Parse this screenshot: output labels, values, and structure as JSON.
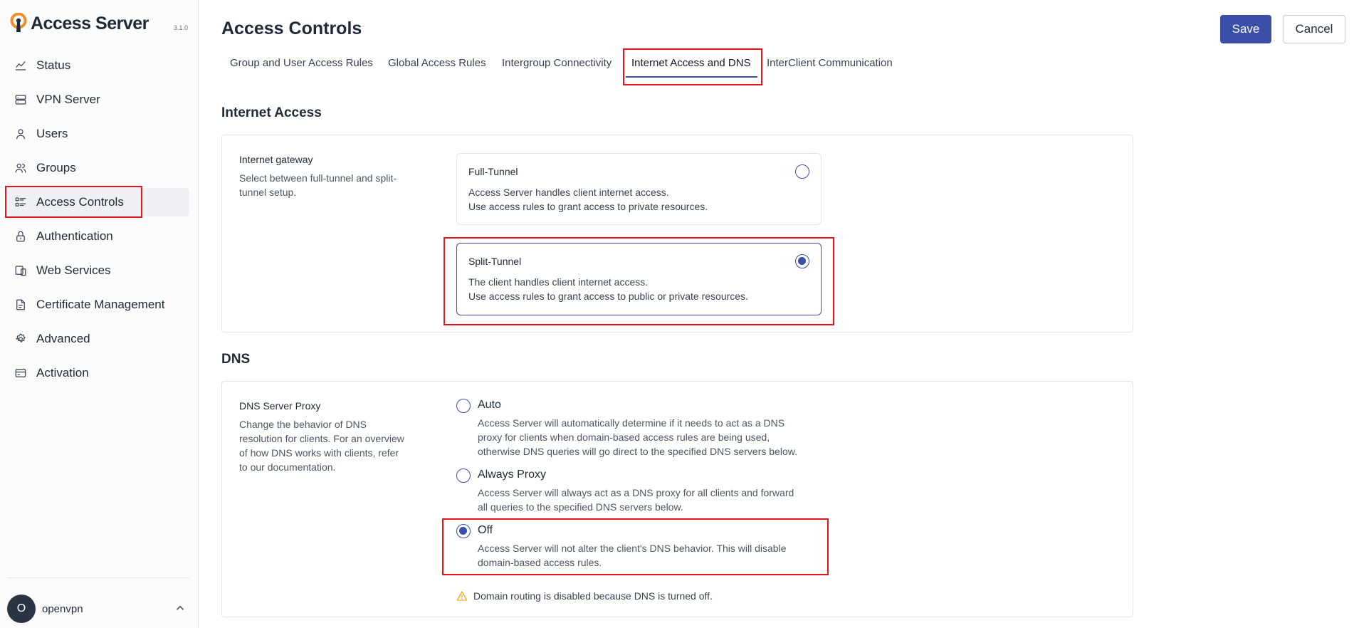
{
  "app": {
    "name": "Access Server",
    "version": "3.1.0"
  },
  "sidebar": {
    "items": [
      {
        "label": "Status",
        "icon": "chart-line-icon"
      },
      {
        "label": "VPN Server",
        "icon": "server-icon"
      },
      {
        "label": "Users",
        "icon": "user-icon"
      },
      {
        "label": "Groups",
        "icon": "users-icon"
      },
      {
        "label": "Access Controls",
        "icon": "list-check-icon",
        "active": true
      },
      {
        "label": "Authentication",
        "icon": "lock-icon"
      },
      {
        "label": "Web Services",
        "icon": "devices-icon"
      },
      {
        "label": "Certificate Management",
        "icon": "file-certificate-icon"
      },
      {
        "label": "Advanced",
        "icon": "gear-icon"
      },
      {
        "label": "Activation",
        "icon": "credit-card-icon"
      }
    ],
    "user": {
      "initial": "O",
      "name": "openvpn"
    }
  },
  "header": {
    "title": "Access Controls",
    "save_label": "Save",
    "cancel_label": "Cancel"
  },
  "tabs": [
    {
      "label": "Group and User Access Rules"
    },
    {
      "label": "Global Access Rules"
    },
    {
      "label": "Intergroup Connectivity"
    },
    {
      "label": "Internet Access and DNS",
      "active": true
    },
    {
      "label": "InterClient Communication"
    }
  ],
  "internet_access": {
    "section_title": "Internet Access",
    "field_label": "Internet gateway",
    "field_desc_1": "Select between full-tunnel and split-",
    "field_desc_2": "tunnel setup.",
    "options": [
      {
        "title": "Full-Tunnel",
        "desc_1": "Access Server handles client internet access.",
        "desc_2": "Use access rules to grant access to private resources.",
        "selected": false
      },
      {
        "title": "Split-Tunnel",
        "desc_1": "The client handles client internet access.",
        "desc_2": "Use access rules to grant access to public or private resources.",
        "selected": true
      }
    ]
  },
  "dns": {
    "section_title": "DNS",
    "field_label": "DNS Server Proxy",
    "field_desc": [
      "Change the behavior of DNS",
      "resolution for clients. For an overview",
      "of how DNS works with clients, refer",
      "to our documentation."
    ],
    "options": [
      {
        "title": "Auto",
        "desc": [
          "Access Server will automatically determine if it needs to act as a DNS",
          "proxy for clients when domain-based access rules are being used,",
          "otherwise DNS queries will go direct to the specified DNS servers below."
        ],
        "selected": false
      },
      {
        "title": "Always Proxy",
        "desc": [
          "Access Server will always act as a DNS proxy for all clients and forward",
          "all queries to the specified DNS servers below."
        ],
        "selected": false
      },
      {
        "title": "Off",
        "desc": [
          "Access Server will not alter the client's DNS behavior. This will disable",
          "domain-based access rules."
        ],
        "selected": true
      }
    ],
    "warning": "Domain routing is disabled because DNS is turned off."
  },
  "colors": {
    "accent": "#3b4fa8",
    "highlight": "#e5141b",
    "warning": "#f5a524",
    "logo": "#f28c28"
  }
}
